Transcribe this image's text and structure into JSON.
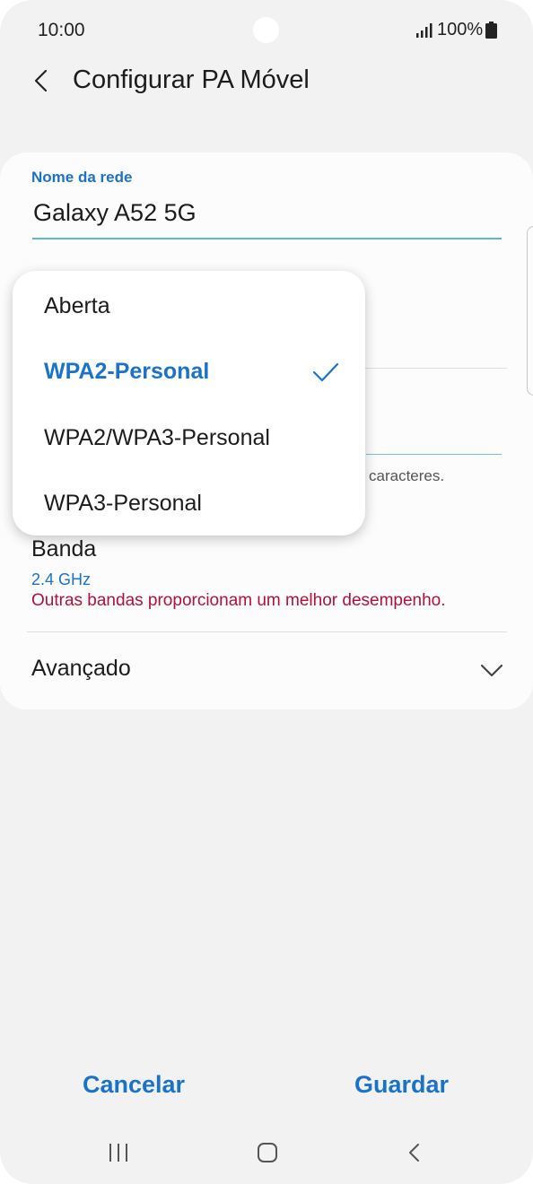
{
  "status_bar": {
    "time": "10:00",
    "battery": "100%"
  },
  "header": {
    "title": "Configurar PA Móvel"
  },
  "network_name": {
    "label": "Nome da rede",
    "value": "Galaxy A52 5G"
  },
  "password_hint": "caracteres.",
  "band": {
    "label": "Banda",
    "value": "2.4 GHz",
    "warning": "Outras bandas proporcionam um melhor desempenho."
  },
  "advanced": {
    "label": "Avançado"
  },
  "security_dropdown": {
    "options": [
      {
        "label": "Aberta",
        "selected": false
      },
      {
        "label": "WPA2-Personal",
        "selected": true
      },
      {
        "label": "WPA2/WPA3-Personal",
        "selected": false
      },
      {
        "label": "WPA3-Personal",
        "selected": false
      }
    ]
  },
  "actions": {
    "cancel": "Cancelar",
    "save": "Guardar"
  },
  "colors": {
    "accent": "#1a73c9",
    "warning": "#b2103a",
    "background": "#f2f2f2",
    "card": "#fcfcfc"
  },
  "icons": [
    "back-icon",
    "signal-icon",
    "battery-icon",
    "check-icon",
    "chevron-down-icon",
    "recent-apps-icon",
    "home-icon",
    "nav-back-icon"
  ]
}
